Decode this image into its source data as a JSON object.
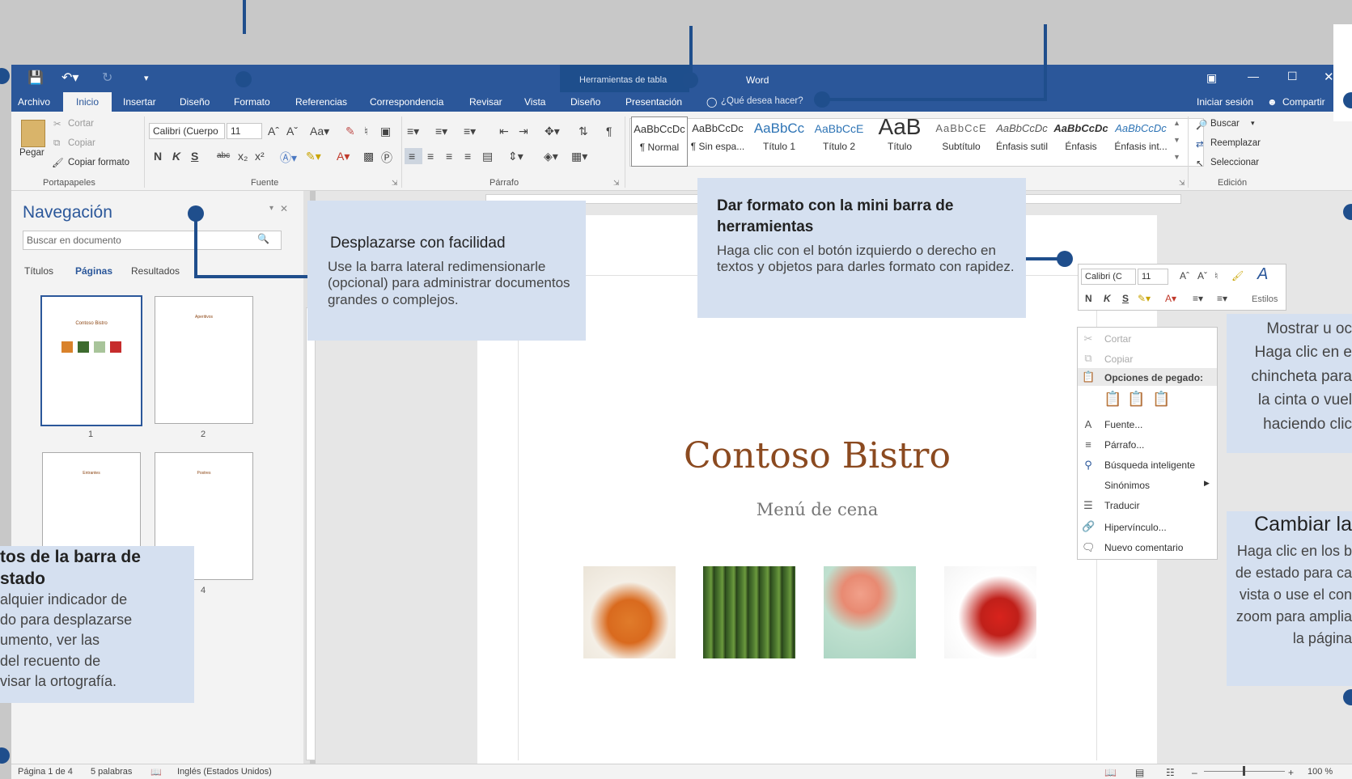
{
  "window": {
    "context_title": "Herramientas de tabla",
    "app_title": "Word",
    "signin": "Iniciar sesión",
    "share": "Compartir",
    "tell_me": "¿Qué desea hacer?"
  },
  "tabs": [
    "Archivo",
    "Inicio",
    "Insertar",
    "Diseño",
    "Formato",
    "Referencias",
    "Correspondencia",
    "Revisar",
    "Vista",
    "Diseño",
    "Presentación"
  ],
  "ribbon": {
    "clipboard": {
      "paste": "Pegar",
      "cut": "Cortar",
      "copy": "Copiar",
      "format_painter": "Copiar formato",
      "group": "Portapapeles"
    },
    "font": {
      "name": "Calibri (Cuerpo",
      "size": "11",
      "group": "Fuente",
      "bold": "N",
      "italic": "K",
      "underline": "S",
      "strike": "abc"
    },
    "paragraph": {
      "group": "Párrafo"
    },
    "styles": [
      {
        "sample": "AaBbCcDc",
        "label": "¶ Normal"
      },
      {
        "sample": "AaBbCcDc",
        "label": "¶ Sin espa..."
      },
      {
        "sample": "AaBbCc",
        "label": "Título 1"
      },
      {
        "sample": "AaBbCcE",
        "label": "Título 2"
      },
      {
        "sample": "AaB",
        "label": "Título"
      },
      {
        "sample": "AaBbCcE",
        "label": "Subtítulo"
      },
      {
        "sample": "AaBbCcDc",
        "label": "Énfasis sutil"
      },
      {
        "sample": "AaBbCcDc",
        "label": "Énfasis"
      },
      {
        "sample": "AaBbCcDc",
        "label": "Énfasis int..."
      }
    ],
    "editing": {
      "find": "Buscar",
      "replace": "Reemplazar",
      "select": "Seleccionar",
      "group": "Edición"
    }
  },
  "nav": {
    "title": "Navegación",
    "search_placeholder": "Buscar en documento",
    "tabs": [
      "Títulos",
      "Páginas",
      "Resultados"
    ],
    "pages": [
      "1",
      "2",
      "4"
    ],
    "thumb_texts": [
      "Contoso Bistro",
      "Aperitivos",
      "Entrantes",
      "Postres"
    ]
  },
  "document": {
    "title": "Contoso Bistro",
    "subtitle": "Menú de cena"
  },
  "mini_toolbar": {
    "font": "Calibri (C",
    "size": "11",
    "styles": "Estilos",
    "bold": "N",
    "italic": "K",
    "underline": "S"
  },
  "context_menu": {
    "cut": "Cortar",
    "copy": "Copiar",
    "paste_options": "Opciones de pegado:",
    "font": "Fuente...",
    "paragraph": "Párrafo...",
    "smart_lookup": "Búsqueda inteligente",
    "synonyms": "Sinónimos",
    "translate": "Traducir",
    "hyperlink": "Hipervínculo...",
    "new_comment": "Nuevo comentario"
  },
  "callouts": {
    "navigate": {
      "title": "Desplazarse con facilidad",
      "text": "Use la barra lateral redimensionarle (opcional) para administrar documentos grandes o complejos."
    },
    "format": {
      "title": "Dar formato con la mini barra de herramientas",
      "text": "Haga clic con el botón izquierdo o derecho en textos y objetos para darles formato con rapidez."
    },
    "status": {
      "title": "tos de la barra de\nstado",
      "text": "alquier indicador de\ndo para desplazarse\numento, ver las\n del recuento de\nvisar la ortografía."
    },
    "ribbon": {
      "text": "Mostrar u oc\nHaga clic en e\nchincheta para\nla cinta o vuel\nhaciendo clic"
    },
    "view": {
      "title": "Cambiar la",
      "text": "Haga clic en los b\nde estado para ca\nvista o use el con\nzoom para amplia\nla página"
    }
  },
  "status": {
    "page": "Página 1 de 4",
    "words": "5 palabras",
    "language": "Inglés (Estados Unidos)",
    "zoom": "100 %"
  }
}
